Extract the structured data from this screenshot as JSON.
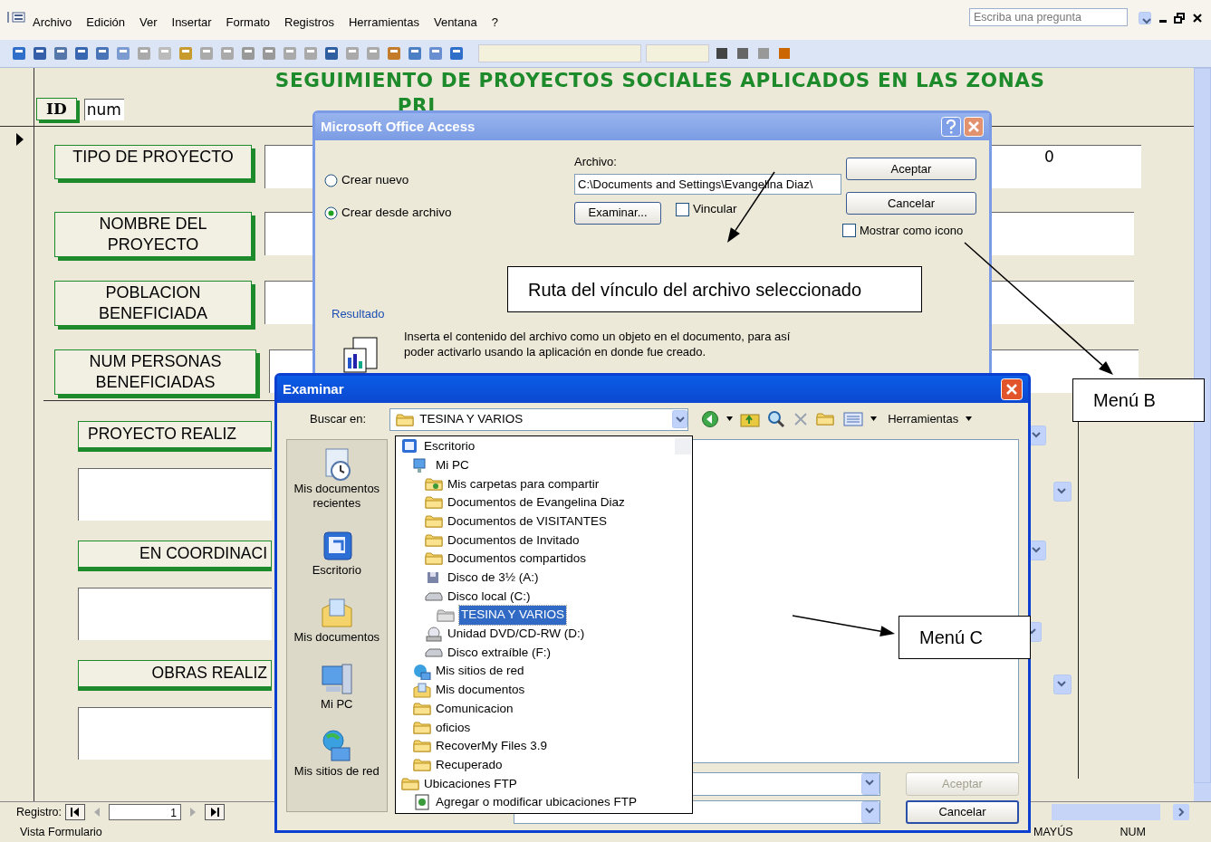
{
  "menu_bar": {
    "items": [
      {
        "label": "Archivo"
      },
      {
        "label": "Edición"
      },
      {
        "label": "Ver"
      },
      {
        "label": "Insertar"
      },
      {
        "label": "Formato"
      },
      {
        "label": "Registros"
      },
      {
        "label": "Herramientas"
      },
      {
        "label": "Ventana"
      },
      {
        "label": "?"
      }
    ],
    "help_placeholder": "Escriba una pregunta"
  },
  "form": {
    "title_lines": [
      "SEGUIMIENTO DE PROYECTOS SOCIALES APLICADOS EN LAS ZONAS",
      "PRI"
    ],
    "id_label": "ID",
    "id_value": "num",
    "extra_value": "0",
    "fields": [
      {
        "label": "TIPO DE PROYECTO"
      },
      {
        "label": "NOMBRE DEL PROYECTO"
      },
      {
        "label": "POBLACION BENEFICIADA"
      },
      {
        "label": "NUM PERSONAS BENEFICIADAS"
      }
    ],
    "sections": [
      {
        "label": "PROYECTO REALIZ"
      },
      {
        "label": "EN COORDINACI"
      },
      {
        "label": "OBRAS REALIZ"
      }
    ]
  },
  "record_nav": {
    "label": "Registro:",
    "value": "1"
  },
  "status_bar": {
    "mode": "Vista Formulario",
    "indicators": [
      "MAYÚS",
      "NUM"
    ]
  },
  "insert_dialog": {
    "title": "Microsoft Office Access",
    "options": [
      {
        "label": "Crear nuevo",
        "selected": false
      },
      {
        "label": "Crear desde archivo",
        "selected": true
      }
    ],
    "file_label": "Archivo:",
    "file_value": "C:\\Documents and Settings\\Evangelina Diaz\\",
    "browse_button": "Examinar...",
    "link_checkbox": {
      "label": "Vincular",
      "checked": false
    },
    "buttons": [
      "Aceptar",
      "Cancelar"
    ],
    "icon_checkbox": {
      "label": "Mostrar como icono",
      "checked": false
    },
    "result_label": "Resultado",
    "result_text": "Inserta el contenido del archivo como un objeto en el documento, para así poder activarlo usando la aplicación en donde fue creado."
  },
  "browse_dialog": {
    "title": "Examinar",
    "look_in_label": "Buscar en:",
    "look_in_value": "TESINA Y VARIOS",
    "tools_label": "Herramientas",
    "places": [
      {
        "label": "Mis documentos recientes",
        "kind": "recent"
      },
      {
        "label": "Escritorio",
        "kind": "desktop"
      },
      {
        "label": "Mis documentos",
        "kind": "documents"
      },
      {
        "label": "Mi PC",
        "kind": "computer"
      },
      {
        "label": "Mis sitios de red",
        "kind": "network"
      }
    ],
    "tree": [
      {
        "label": "Escritorio",
        "kind": "desktop",
        "selected": false,
        "children": [
          {
            "label": "Mi PC",
            "kind": "computer",
            "selected": false,
            "children": [
              {
                "label": "Mis carpetas para compartir",
                "kind": "shared",
                "selected": false
              },
              {
                "label": "Documentos de Evangelina Diaz",
                "kind": "folder",
                "selected": false
              },
              {
                "label": "Documentos de VISITANTES",
                "kind": "folder",
                "selected": false
              },
              {
                "label": "Documentos de Invitado",
                "kind": "folder",
                "selected": false
              },
              {
                "label": "Documentos compartidos",
                "kind": "folder",
                "selected": false
              },
              {
                "label": "Disco de 3½ (A:)",
                "kind": "floppy",
                "selected": false
              },
              {
                "label": "Disco local (C:)",
                "kind": "drive",
                "selected": false,
                "children": [
                  {
                    "label": "TESINA Y VARIOS",
                    "kind": "folder",
                    "selected": true
                  }
                ]
              },
              {
                "label": "Unidad DVD/CD-RW (D:)",
                "kind": "cd",
                "selected": false
              },
              {
                "label": "Disco extraíble (F:)",
                "kind": "drive",
                "selected": false
              }
            ]
          },
          {
            "label": "Mis sitios de red",
            "kind": "network",
            "selected": false
          },
          {
            "label": "Mis documentos",
            "kind": "documents",
            "selected": false
          },
          {
            "label": "Comunicacion",
            "kind": "folder",
            "selected": false
          },
          {
            "label": "oficios",
            "kind": "folder",
            "selected": false
          },
          {
            "label": "RecoverMy Files 3.9",
            "kind": "folder",
            "selected": false
          },
          {
            "label": "Recuperado",
            "kind": "folder",
            "selected": false
          }
        ]
      },
      {
        "label": "Ubicaciones FTP",
        "kind": "folder",
        "selected": false,
        "children": [
          {
            "label": "Agregar o modificar ubicaciones FTP",
            "kind": "ftp",
            "selected": false
          }
        ]
      }
    ],
    "buttons": [
      {
        "label": "Aceptar",
        "disabled": true
      },
      {
        "label": "Cancelar",
        "disabled": false
      }
    ]
  },
  "annotations": [
    {
      "text": "Ruta del vínculo del archivo seleccionado"
    },
    {
      "text": "Menú B"
    },
    {
      "text": "Menú C"
    }
  ]
}
